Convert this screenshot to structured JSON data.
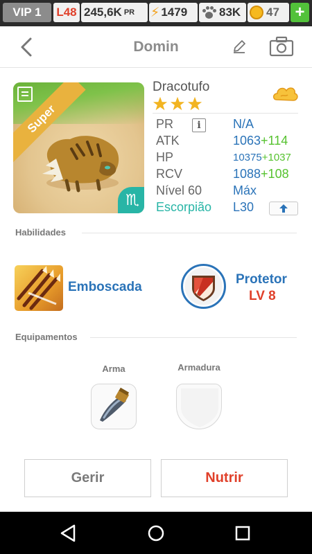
{
  "status_bar": {
    "vip": "VIP 1",
    "level": "L48",
    "power_value": "245,6K",
    "power_unit": "PR",
    "energy": "1479",
    "paws": "83K",
    "coins": "47",
    "plus": "+"
  },
  "header": {
    "title": "Domin"
  },
  "pet": {
    "rarity_ribbon": "Super",
    "name": "Dracotufo",
    "star_count": 3,
    "zodiac_symbol": "♏",
    "stats": [
      {
        "label": "PR",
        "value": "N/A",
        "bonus": ""
      },
      {
        "label": "ATK",
        "value": "1063",
        "bonus": "+114"
      },
      {
        "label": "HP",
        "value": "10375",
        "bonus": "+1037"
      },
      {
        "label": "RCV",
        "value": "1088",
        "bonus": "+108"
      },
      {
        "label": "Nível 60",
        "value": "Máx",
        "bonus": ""
      },
      {
        "label": "Escorpião",
        "value": "L30",
        "bonus": ""
      }
    ]
  },
  "skills_section": {
    "label": "Habilidades",
    "skill1": {
      "name": "Emboscada"
    },
    "skill2": {
      "name": "Protetor",
      "level": "LV 8"
    }
  },
  "equipment_section": {
    "label": "Equipamentos",
    "weapon_label": "Arma",
    "armor_label": "Armadura"
  },
  "actions": {
    "manage": "Gerir",
    "feed": "Nutrir"
  },
  "colors": {
    "accent_blue": "#2a73b8",
    "accent_red": "#e0402a",
    "bonus_green": "#56c22f",
    "zodiac_teal": "#28b5a6",
    "gold": "#e9b23e"
  }
}
